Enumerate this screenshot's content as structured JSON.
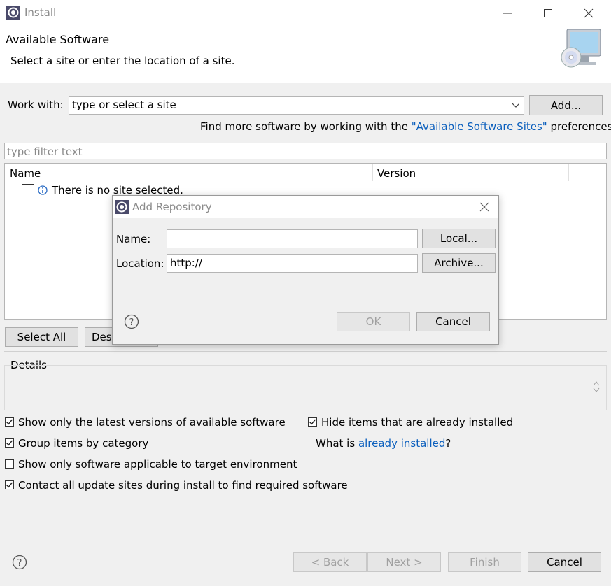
{
  "window": {
    "title": "Install",
    "controls": {
      "minimize": "minimize-icon",
      "maximize": "maximize-icon",
      "close": "close-icon"
    }
  },
  "header": {
    "title": "Available Software",
    "subtitle": "Select a site or enter the location of a site."
  },
  "work_with": {
    "label": "Work with:",
    "placeholder": "type or select a site",
    "add_button": "Add..."
  },
  "find_more": {
    "prefix": "Find more software by working with the ",
    "link": "\"Available Software Sites\"",
    "suffix": " preferences."
  },
  "filter": {
    "placeholder": "type filter text"
  },
  "table": {
    "columns": [
      "Name",
      "Version"
    ],
    "rows": [
      {
        "text": "There is no site selected.",
        "checked": false
      }
    ]
  },
  "buttons": {
    "select_all": "Select All",
    "deselect_all": "Deselect All"
  },
  "details": {
    "label": "Details"
  },
  "options": {
    "show_latest": {
      "label": "Show only the latest versions of available software",
      "checked": true
    },
    "hide_installed": {
      "label": "Hide items that are already installed",
      "checked": true
    },
    "group_by_category": {
      "label": "Group items by category",
      "checked": true
    },
    "what_is": {
      "prefix": "What is ",
      "link": "already installed",
      "suffix": "?"
    },
    "show_applicable": {
      "label": "Show only software applicable to target environment",
      "checked": false
    },
    "contact_sites": {
      "label": "Contact all update sites during install to find required software",
      "checked": true
    }
  },
  "footer": {
    "back": "< Back",
    "next": "Next >",
    "finish": "Finish",
    "cancel": "Cancel"
  },
  "dialog": {
    "title": "Add Repository",
    "name_label": "Name:",
    "name_value": "",
    "location_label": "Location:",
    "location_value": "http://",
    "local_button": "Local...",
    "archive_button": "Archive...",
    "ok_button": "OK",
    "cancel_button": "Cancel"
  }
}
